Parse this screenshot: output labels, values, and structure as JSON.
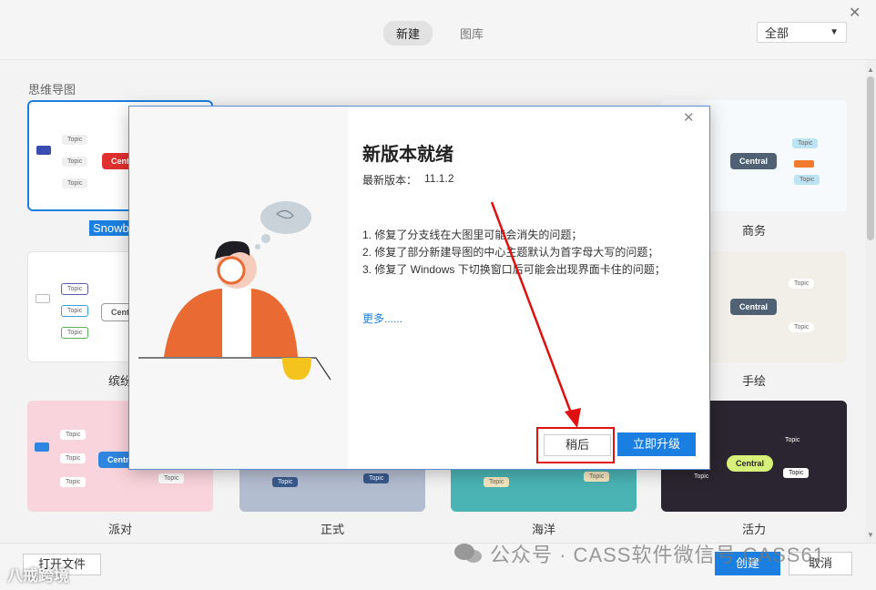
{
  "header": {
    "tabs": [
      {
        "label": "新建",
        "active": true
      },
      {
        "label": "图库",
        "active": false
      }
    ],
    "filter_value": "全部"
  },
  "section_title": "思维导图",
  "templates": [
    {
      "label": "Snowb",
      "selected": true
    },
    {
      "label": "商务"
    },
    {
      "label": "缤纷"
    },
    {
      "label": "手绘"
    },
    {
      "label": "派对"
    },
    {
      "label": "正式"
    },
    {
      "label": "海洋"
    },
    {
      "label": "活力"
    }
  ],
  "node_labels": {
    "topic": "Topic",
    "central": "Central"
  },
  "footer": {
    "open_file": "打开文件",
    "create": "创建",
    "cancel": "取消"
  },
  "modal": {
    "title": "新版本就绪",
    "version_label": "最新版本：",
    "version_value": "11.1.2",
    "changes": [
      "1. 修复了分支线在大图里可能会消失的问题；",
      "2. 修复了部分新建导图的中心主题默认为首字母大写的问题；",
      "3. 修复了 Windows 下切换窗口后可能会出现界面卡住的问题；"
    ],
    "more_link": "更多......",
    "later_button": "稍后",
    "upgrade_button": "立即升级"
  },
  "watermarks": {
    "left": "八戒跨境",
    "right": "公众号 · CASS软件微信号 CASS61"
  },
  "colors": {
    "accent": "#1a7fe0",
    "highlight": "#e01010"
  }
}
